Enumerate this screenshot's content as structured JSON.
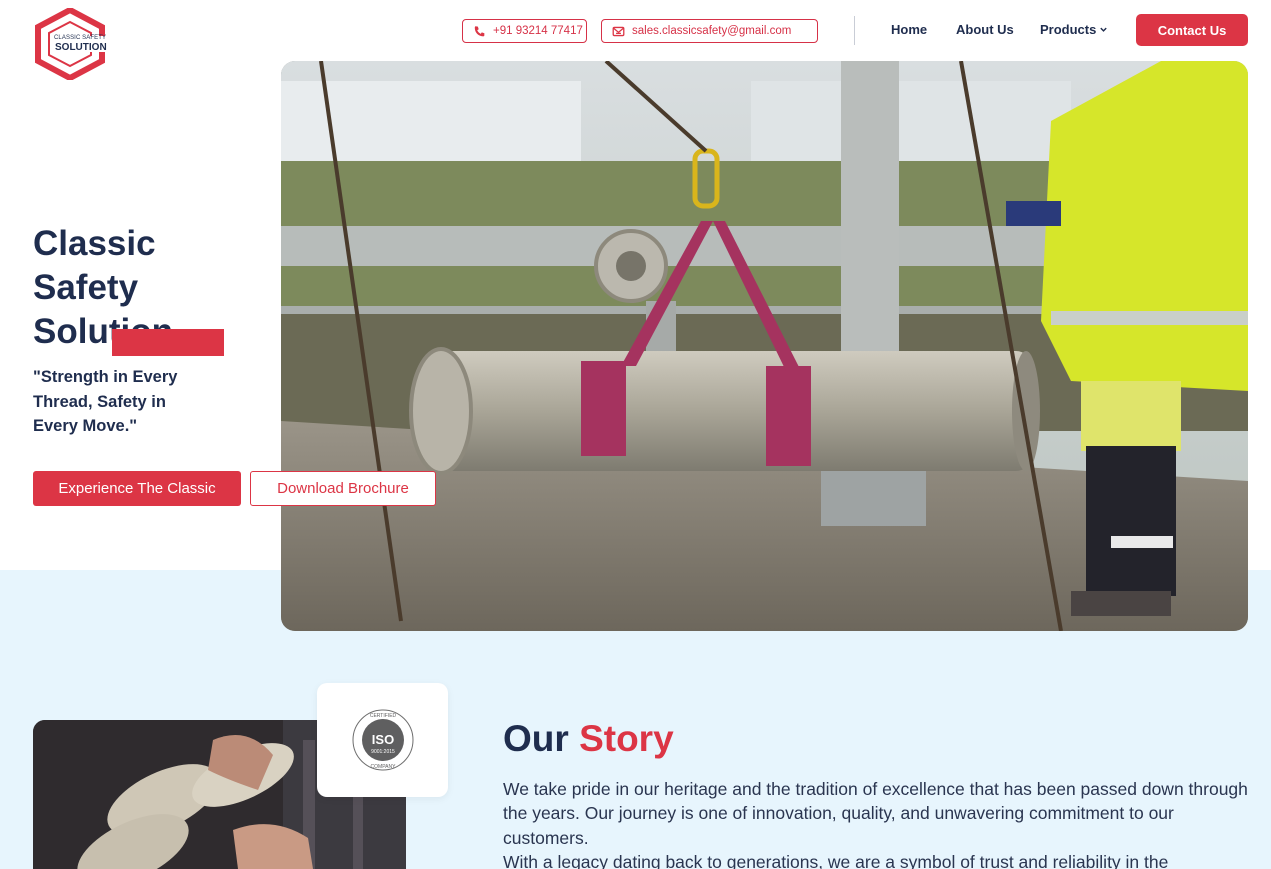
{
  "brand": {
    "logo_small_text": "CLASSIC SAFETY",
    "logo_big_text": "SOLUTION",
    "accent": "#dc3545",
    "navy": "#1f2d4e",
    "band": "#e7f5fd"
  },
  "header": {
    "phone": {
      "icon": "phone-icon",
      "label": "+91 93214 77417"
    },
    "email": {
      "icon": "mail-icon",
      "label": "sales.classicsafety@gmail.com"
    },
    "nav": {
      "home": "Home",
      "about": "About Us",
      "products": "Products",
      "products_icon": "chevron-down-icon"
    },
    "contact_label": "Contact Us"
  },
  "hero": {
    "title": "Classic Safety Solution",
    "tagline": "\"Strength in Every Thread, Safety in Every Move.\"",
    "primary_button": "Experience The Classic",
    "secondary_button": "Download Brochure",
    "image_alt": "Worker lifting a steel pipe with purple round slings"
  },
  "story": {
    "heading_dark": "Our",
    "heading_red": "Story",
    "iso_badge": {
      "top": "CERTIFIED",
      "mark": "ISO",
      "standard": "9001:2015",
      "bottom": "COMPANY"
    },
    "paragraph_1": "We take pride in our heritage and the tradition of excellence that has been passed down through the years. Our journey is one of innovation, quality, and unwavering commitment to our customers.",
    "paragraph_2": "With a legacy dating back to generations, we are a symbol of trust and reliability in the"
  }
}
